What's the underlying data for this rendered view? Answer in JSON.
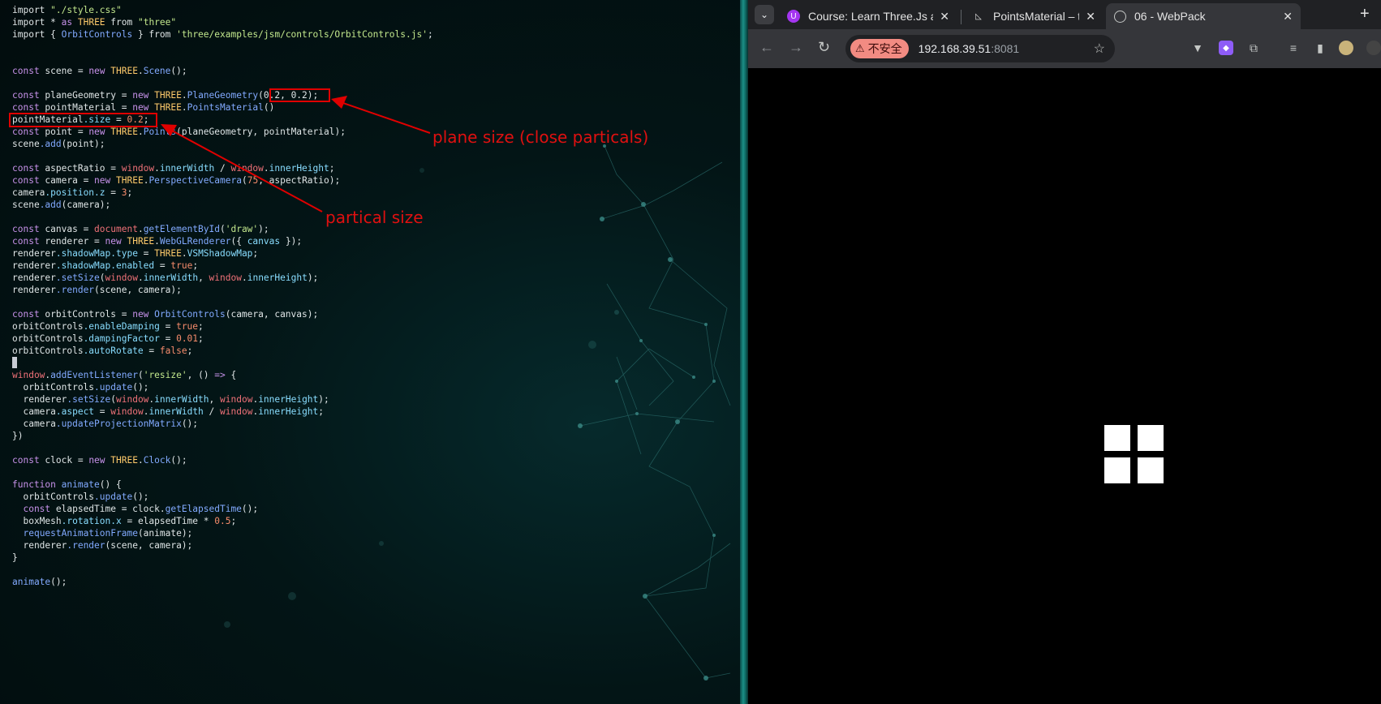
{
  "editor": {
    "lines": [
      [
        [
          "import ",
          ""
        ],
        [
          "\"./style.css\"",
          "str"
        ]
      ],
      [
        [
          "import ",
          ""
        ],
        [
          "* ",
          ""
        ],
        [
          "as ",
          "kw"
        ],
        [
          "THREE ",
          "cls"
        ],
        [
          "from ",
          ""
        ],
        [
          "\"three\"",
          "str"
        ]
      ],
      [
        [
          "import ",
          ""
        ],
        [
          "{ ",
          ""
        ],
        [
          "OrbitControls",
          "fn"
        ],
        [
          " } ",
          ""
        ],
        [
          "from ",
          ""
        ],
        [
          "'three/examples/jsm/controls/OrbitControls.js'",
          "str"
        ],
        [
          ";",
          ""
        ]
      ],
      [],
      [],
      [
        [
          "const ",
          "kw"
        ],
        [
          "scene = ",
          ""
        ],
        [
          "new ",
          "kw"
        ],
        [
          "THREE",
          "cls"
        ],
        [
          ".",
          ""
        ],
        [
          "Scene",
          "fn"
        ],
        [
          "();",
          ""
        ]
      ],
      [],
      [
        [
          "const ",
          "kw"
        ],
        [
          "planeGeometry = ",
          ""
        ],
        [
          "new ",
          "kw"
        ],
        [
          "THREE",
          "cls"
        ],
        [
          ".",
          ""
        ],
        [
          "PlaneGeometry",
          "fn"
        ],
        [
          "(0.2, 0.2);",
          ""
        ]
      ],
      [
        [
          "const ",
          "kw"
        ],
        [
          "pointMaterial = ",
          ""
        ],
        [
          "new ",
          "kw"
        ],
        [
          "THREE",
          "cls"
        ],
        [
          ".",
          ""
        ],
        [
          "PointsMaterial",
          "fn"
        ],
        [
          "()",
          ""
        ]
      ],
      [
        [
          "pointMaterial",
          ""
        ],
        [
          ".size",
          "prop"
        ],
        [
          " = ",
          ""
        ],
        [
          "0.2",
          "num"
        ],
        [
          ";",
          ""
        ]
      ],
      [
        [
          "const ",
          "kw"
        ],
        [
          "point = ",
          ""
        ],
        [
          "new ",
          "kw"
        ],
        [
          "THREE",
          "cls"
        ],
        [
          ".",
          ""
        ],
        [
          "Points",
          "fn"
        ],
        [
          "(planeGeometry, pointMaterial);",
          ""
        ]
      ],
      [
        [
          "scene",
          ""
        ],
        [
          ".add",
          "fn"
        ],
        [
          "(point);",
          ""
        ]
      ],
      [],
      [
        [
          "const ",
          "kw"
        ],
        [
          "aspectRatio = ",
          ""
        ],
        [
          "window",
          "glb"
        ],
        [
          ".",
          ""
        ],
        [
          "innerWidth",
          "prop"
        ],
        [
          " / ",
          ""
        ],
        [
          "window",
          "glb"
        ],
        [
          ".",
          ""
        ],
        [
          "innerHeight",
          "prop"
        ],
        [
          ";",
          ""
        ]
      ],
      [
        [
          "const ",
          "kw"
        ],
        [
          "camera = ",
          ""
        ],
        [
          "new ",
          "kw"
        ],
        [
          "THREE",
          "cls"
        ],
        [
          ".",
          ""
        ],
        [
          "PerspectiveCamera",
          "fn"
        ],
        [
          "(",
          ""
        ],
        [
          "75",
          "num"
        ],
        [
          ", aspectRatio);",
          ""
        ]
      ],
      [
        [
          "camera",
          ""
        ],
        [
          ".position",
          "prop"
        ],
        [
          ".z",
          "prop"
        ],
        [
          " = ",
          ""
        ],
        [
          "3",
          "num"
        ],
        [
          ";",
          ""
        ]
      ],
      [
        [
          "scene",
          ""
        ],
        [
          ".add",
          "fn"
        ],
        [
          "(camera);",
          ""
        ]
      ],
      [],
      [
        [
          "const ",
          "kw"
        ],
        [
          "canvas = ",
          ""
        ],
        [
          "document",
          "glb"
        ],
        [
          ".",
          ""
        ],
        [
          "getElementById",
          "fn"
        ],
        [
          "(",
          ""
        ],
        [
          "'draw'",
          "str"
        ],
        [
          ");",
          ""
        ]
      ],
      [
        [
          "const ",
          "kw"
        ],
        [
          "renderer = ",
          ""
        ],
        [
          "new ",
          "kw"
        ],
        [
          "THREE",
          "cls"
        ],
        [
          ".",
          ""
        ],
        [
          "WebGLRenderer",
          "fn"
        ],
        [
          "({ ",
          ""
        ],
        [
          "canvas",
          "prop"
        ],
        [
          " });",
          ""
        ]
      ],
      [
        [
          "renderer",
          ""
        ],
        [
          ".shadowMap",
          "prop"
        ],
        [
          ".type",
          "prop"
        ],
        [
          " = ",
          ""
        ],
        [
          "THREE",
          "cls"
        ],
        [
          ".",
          ""
        ],
        [
          "VSMShadowMap",
          "prop"
        ],
        [
          ";",
          ""
        ]
      ],
      [
        [
          "renderer",
          ""
        ],
        [
          ".shadowMap",
          "prop"
        ],
        [
          ".enabled",
          "prop"
        ],
        [
          " = ",
          ""
        ],
        [
          "true",
          "num"
        ],
        [
          ";",
          ""
        ]
      ],
      [
        [
          "renderer",
          ""
        ],
        [
          ".setSize",
          "fn"
        ],
        [
          "(",
          ""
        ],
        [
          "window",
          "glb"
        ],
        [
          ".",
          ""
        ],
        [
          "innerWidth",
          "prop"
        ],
        [
          ", ",
          ""
        ],
        [
          "window",
          "glb"
        ],
        [
          ".",
          ""
        ],
        [
          "innerHeight",
          "prop"
        ],
        [
          ");",
          ""
        ]
      ],
      [
        [
          "renderer",
          ""
        ],
        [
          ".render",
          "fn"
        ],
        [
          "(scene, camera);",
          ""
        ]
      ],
      [],
      [
        [
          "const ",
          "kw"
        ],
        [
          "orbitControls = ",
          ""
        ],
        [
          "new ",
          "kw"
        ],
        [
          "OrbitControls",
          "fn"
        ],
        [
          "(camera, canvas);",
          ""
        ]
      ],
      [
        [
          "orbitControls",
          ""
        ],
        [
          ".enableDamping",
          "prop"
        ],
        [
          " = ",
          ""
        ],
        [
          "true",
          "num"
        ],
        [
          ";",
          ""
        ]
      ],
      [
        [
          "orbitControls",
          ""
        ],
        [
          ".dampingFactor",
          "prop"
        ],
        [
          " = ",
          ""
        ],
        [
          "0.01",
          "num"
        ],
        [
          ";",
          ""
        ]
      ],
      [
        [
          "orbitControls",
          ""
        ],
        [
          ".autoRotate",
          "prop"
        ],
        [
          " = ",
          ""
        ],
        [
          "false",
          "num"
        ],
        [
          ";",
          ""
        ]
      ],
      [],
      [
        [
          "window",
          "glb"
        ],
        [
          ".",
          ""
        ],
        [
          "addEventListener",
          "fn"
        ],
        [
          "(",
          ""
        ],
        [
          "'resize'",
          "str"
        ],
        [
          ", () ",
          ""
        ],
        [
          "=>",
          "kw"
        ],
        [
          " {",
          ""
        ]
      ],
      [
        [
          "  orbitControls",
          ""
        ],
        [
          ".update",
          "fn"
        ],
        [
          "();",
          ""
        ]
      ],
      [
        [
          "  renderer",
          ""
        ],
        [
          ".setSize",
          "fn"
        ],
        [
          "(",
          ""
        ],
        [
          "window",
          "glb"
        ],
        [
          ".",
          ""
        ],
        [
          "innerWidth",
          "prop"
        ],
        [
          ", ",
          ""
        ],
        [
          "window",
          "glb"
        ],
        [
          ".",
          ""
        ],
        [
          "innerHeight",
          "prop"
        ],
        [
          ");",
          ""
        ]
      ],
      [
        [
          "  camera",
          ""
        ],
        [
          ".aspect",
          "prop"
        ],
        [
          " = ",
          ""
        ],
        [
          "window",
          "glb"
        ],
        [
          ".",
          ""
        ],
        [
          "innerWidth",
          "prop"
        ],
        [
          " / ",
          ""
        ],
        [
          "window",
          "glb"
        ],
        [
          ".",
          ""
        ],
        [
          "innerHeight",
          "prop"
        ],
        [
          ";",
          ""
        ]
      ],
      [
        [
          "  camera",
          ""
        ],
        [
          ".updateProjectionMatrix",
          "fn"
        ],
        [
          "();",
          ""
        ]
      ],
      [
        [
          "})",
          ""
        ]
      ],
      [],
      [
        [
          "const ",
          "kw"
        ],
        [
          "clock = ",
          ""
        ],
        [
          "new ",
          "kw"
        ],
        [
          "THREE",
          "cls"
        ],
        [
          ".",
          ""
        ],
        [
          "Clock",
          "fn"
        ],
        [
          "();",
          ""
        ]
      ],
      [],
      [
        [
          "function ",
          "kw"
        ],
        [
          "animate",
          "fn"
        ],
        [
          "() {",
          ""
        ]
      ],
      [
        [
          "  orbitControls",
          ""
        ],
        [
          ".update",
          "fn"
        ],
        [
          "();",
          ""
        ]
      ],
      [
        [
          "  const ",
          "kw"
        ],
        [
          "elapsedTime = clock",
          ""
        ],
        [
          ".",
          ""
        ],
        [
          "getElapsedTime",
          "fn"
        ],
        [
          "();",
          ""
        ]
      ],
      [
        [
          "  boxMesh",
          ""
        ],
        [
          ".rotation",
          "prop"
        ],
        [
          ".x",
          "prop"
        ],
        [
          " = elapsedTime * ",
          ""
        ],
        [
          "0.5",
          "num"
        ],
        [
          ";",
          ""
        ]
      ],
      [
        [
          "  ",
          ""
        ],
        [
          "requestAnimationFrame",
          "fn"
        ],
        [
          "(animate);",
          ""
        ]
      ],
      [
        [
          "  renderer",
          ""
        ],
        [
          ".render",
          "fn"
        ],
        [
          "(scene, camera);",
          ""
        ]
      ],
      [
        [
          "}",
          ""
        ]
      ],
      [],
      [
        [
          "animate",
          "fn"
        ],
        [
          "();",
          ""
        ]
      ]
    ],
    "cursor_line": 29,
    "annotations": {
      "plane_label": "plane size (close particals)",
      "particle_label": "partical size"
    },
    "annotation_color": "#e00000"
  },
  "browser": {
    "tab_menu_icon": "chevron-down-icon",
    "tabs": [
      {
        "title": "Course: Learn Three.Js a",
        "favicon": "udemy-icon",
        "close": "✕",
        "active": false
      },
      {
        "title": "PointsMaterial – three.js",
        "favicon": "threejs-icon",
        "close": "✕",
        "active": false
      },
      {
        "title": "06 - WebPack",
        "favicon": "globe-icon",
        "close": "✕",
        "active": true
      }
    ],
    "new_tab": "+",
    "security_label": "不安全",
    "url_host": "192.168.39.51",
    "url_port": ":8081",
    "viewport_background": "#000000",
    "particle_color": "#ffffff"
  }
}
